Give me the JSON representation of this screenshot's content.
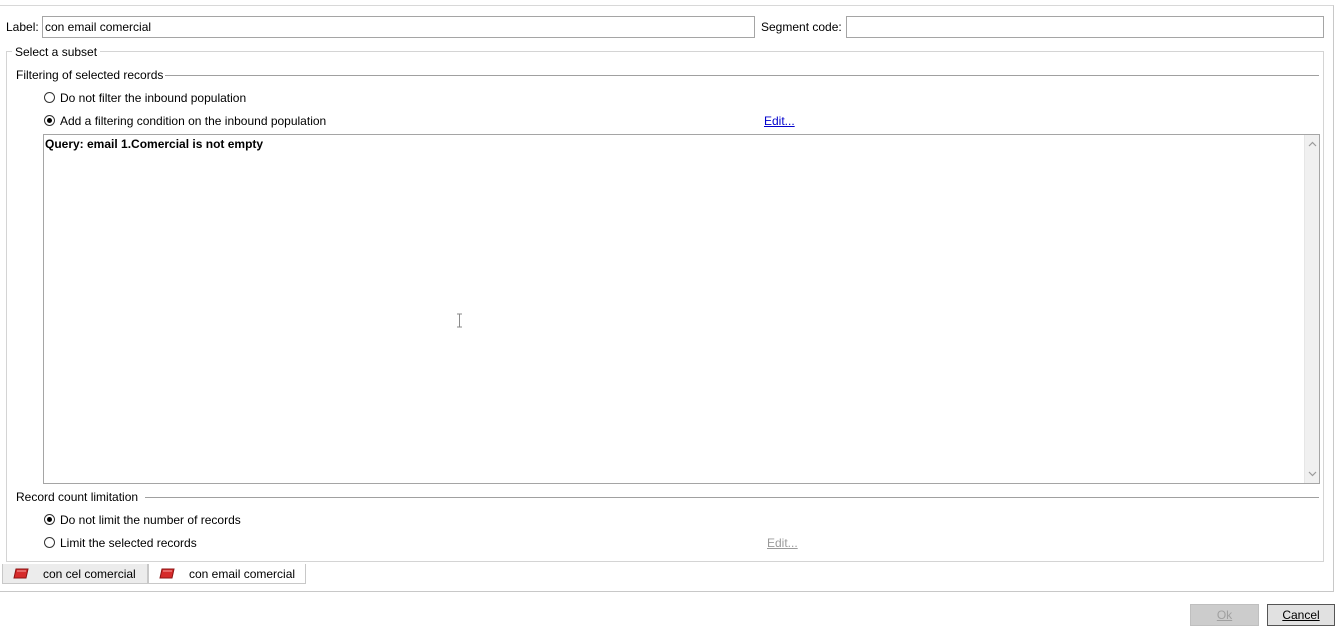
{
  "header": {
    "label_caption": "Label:",
    "label_value": "con email comercial",
    "segment_caption": "Segment code:",
    "segment_value": ""
  },
  "subset": {
    "group_title": "Select a subset",
    "filtering": {
      "section_title": "Filtering of selected records",
      "options": [
        {
          "label": "Do not filter the inbound population",
          "selected": false
        },
        {
          "label": "Add a filtering condition on the inbound population",
          "selected": true
        }
      ],
      "edit_link": "Edit...",
      "query_text": "Query: email 1.Comercial is not empty"
    },
    "limitation": {
      "section_title": "Record count limitation",
      "options": [
        {
          "label": "Do not limit the number of records",
          "selected": true
        },
        {
          "label": "Limit the selected records",
          "selected": false
        }
      ],
      "edit_link": "Edit..."
    }
  },
  "tabs": [
    {
      "label": "con cel comercial",
      "icon": "segment-icon",
      "active": false
    },
    {
      "label": "con email comercial",
      "icon": "segment-icon",
      "active": true
    }
  ],
  "buttons": {
    "ok_label": "Ok",
    "cancel_label": "Cancel"
  },
  "colors": {
    "link": "#0000cc",
    "tab_icon": "#d62a2a"
  }
}
